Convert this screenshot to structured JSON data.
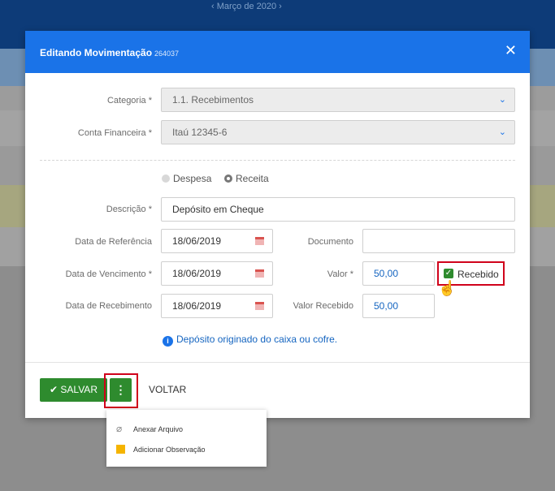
{
  "background": {
    "month": "‹   Março de 2020   ›"
  },
  "modal": {
    "title": "Editando Movimentação",
    "id": "264037",
    "close": "✕"
  },
  "form": {
    "categoria": {
      "label": "Categoria *",
      "value": "1.1. Recebimentos"
    },
    "conta": {
      "label": "Conta Financeira *",
      "value": "Itaú 12345-6"
    },
    "tipo": {
      "despesa": "Despesa",
      "receita": "Receita",
      "selected": "Receita"
    },
    "descricao": {
      "label": "Descrição *",
      "value": "Depósito em Cheque"
    },
    "data_referencia": {
      "label": "Data de Referência",
      "value": "18/06/2019"
    },
    "documento": {
      "label": "Documento",
      "value": ""
    },
    "data_vencimento": {
      "label": "Data de Vencimento *",
      "value": "18/06/2019"
    },
    "valor": {
      "label": "Valor *",
      "value": "50,00"
    },
    "recebido": {
      "label": "Recebido",
      "checked": true
    },
    "data_recebimento": {
      "label": "Data de Recebimento",
      "value": "18/06/2019"
    },
    "valor_recebido": {
      "label": "Valor Recebido",
      "value": "50,00"
    },
    "info": "Depósito originado do caixa ou cofre."
  },
  "footer": {
    "save": "SALVAR",
    "more": "⋮",
    "back": "VOLTAR"
  },
  "dropdown": {
    "items": [
      {
        "label": "Anexar Arquivo",
        "icon": "paperclip-icon"
      },
      {
        "label": "Adicionar Observação",
        "icon": "note-icon"
      }
    ]
  },
  "colors": {
    "primary": "#1a73e8",
    "success": "#2e8b2e",
    "highlight": "#d0021b"
  }
}
